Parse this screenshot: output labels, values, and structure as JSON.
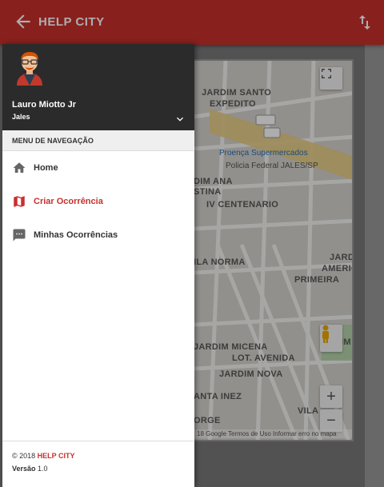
{
  "app": {
    "title": "HELP CITY"
  },
  "user": {
    "name": "Lauro Miotto Jr",
    "city": "Jales"
  },
  "menu": {
    "title": "MENU DE NAVEGAÇÃO",
    "items": [
      {
        "label": "Home",
        "icon": "home-icon"
      },
      {
        "label": "Criar Ocorrência",
        "icon": "map-icon",
        "active": true
      },
      {
        "label": "Minhas Ocorrências",
        "icon": "comment-icon"
      }
    ]
  },
  "footer": {
    "copyright": "© 2018",
    "brand": "HELP CITY",
    "version_label": "Versão",
    "version": "1.0"
  },
  "map": {
    "labels": [
      "JARDIM SANTO",
      "EXPEDITO",
      "DIM ANA",
      "STINA",
      "IV CENTENARIO",
      "ILA NORMA",
      "JARDIM MICENA",
      "LOT. AVENIDA",
      "JARDIM NOVA",
      "ANTA INEZ",
      "JARDI",
      "AMERICA",
      "PRIMEIRA",
      "IM",
      "ORGE",
      "VILA"
    ],
    "pois": [
      "Proença Supermercados",
      "Policia Federal JALES/SP"
    ],
    "road_badges": [
      "584B",
      "584"
    ],
    "attribution": "18 Google   Termos de Uso   Informar erro no mapa"
  },
  "colors": {
    "primary": "#c9302c",
    "drawer_header": "#2b2b2b"
  }
}
